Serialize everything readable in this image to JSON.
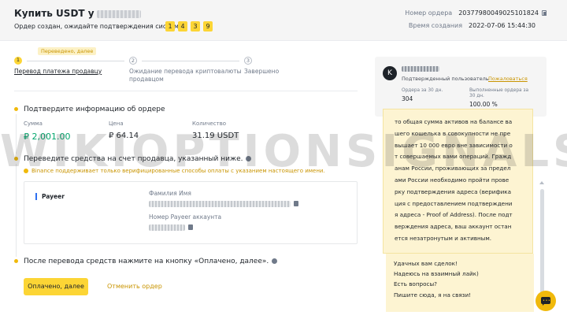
{
  "header": {
    "title": "Купить USDT у",
    "subtitle": "Ордер создан, ожидайте подтверждения системы.",
    "timer": [
      "1",
      "4",
      "3",
      "9"
    ],
    "order_number_label": "Номер ордера",
    "order_number": "20377980049025101824",
    "created_label": "Время создания",
    "created": "2022-07-06 15:44:30"
  },
  "steps": {
    "badge": "Переведено, далее",
    "items": [
      {
        "num": "1",
        "label": "Перевод платежа продавцу"
      },
      {
        "num": "2",
        "label": "Ожидание перевода криптовалюты продавцом"
      },
      {
        "num": "3",
        "label": "Завершено"
      }
    ]
  },
  "confirm": {
    "title": "Подтвердите информацию об ордере",
    "sum_label": "Сумма",
    "sum": "₽ 2,001.00",
    "price_label": "Цена",
    "price": "₽ 64.14",
    "qty_label": "Количество",
    "qty": "31.19 USDT"
  },
  "transfer": {
    "title": "Переведите средства на счет продавца, указанный ниже.",
    "warning": "Binance поддерживает только верифицированные способы оплаты с указанием настоящего имени.",
    "method": "Payeer",
    "surname_label": "Фамилия Имя",
    "account_label": "Номер Payeer аккаунта"
  },
  "after": {
    "title": "После перевода средств нажмите на кнопку «Оплачено, далее».",
    "paid_button": "Оплачено, далее",
    "cancel_button": "Отменить ордер"
  },
  "seller": {
    "avatar_letter": "K",
    "verified": "Подтвержденный пользователь",
    "report": "Пожаловаться",
    "orders_label": "Ордера за 30 дн.",
    "orders": "304",
    "completed_label": "Выполненные ордера за 30 дн.",
    "completed": "100.00 %"
  },
  "chat": {
    "message": "то общая сумма активов на балансе ва\nшего кошелька в совокупности не пре\nвышает 10 000 евро вне зависимости о\nт совершаемых вами операций. Гражд\nанам России, проживающих за предел\nами России необходимо пройти прове\nрку подтверждения адреса (верифика\nция с предоставлением подтверждени\nя адреса - Proof of Address). После подт\nверждения адреса, ваш аккаунт остан\nется незатронутым и активным.",
    "tail": "Удачных вам сделок!\nНадеюсь на взаимный лайк)\nЕсть вопросы?\nПишите сюда, я на связи!"
  },
  "watermark": "WIKIOPTIONSIGNALS.COM"
}
